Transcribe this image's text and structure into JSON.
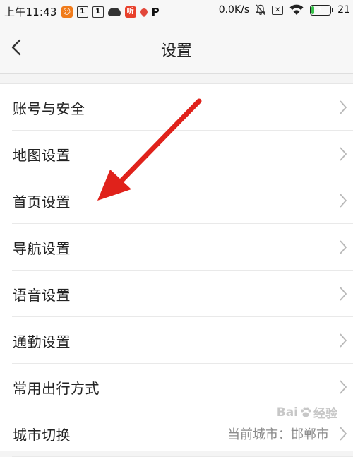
{
  "status_bar": {
    "time": "上午11:43",
    "icons": [
      {
        "name": "app-notification-icon",
        "glyph": "☺",
        "style": "orange"
      },
      {
        "name": "box-one-icon",
        "glyph": "1",
        "style": "box"
      },
      {
        "name": "box-one-icon",
        "glyph": "1",
        "style": "box"
      },
      {
        "name": "cloud-icon",
        "glyph": "",
        "style": "cloud"
      },
      {
        "name": "listen-app-icon",
        "glyph": "听",
        "style": "red"
      },
      {
        "name": "location-pin-icon",
        "glyph": "",
        "style": "pin"
      },
      {
        "name": "p-app-icon",
        "glyph": "P",
        "style": "p"
      }
    ],
    "net_speed": "0.0K/s",
    "battery_level": "21",
    "battery_percent": 0.21,
    "accent_green": "#37c24a"
  },
  "header": {
    "title": "设置",
    "back_icon": "chevron-left-icon"
  },
  "settings": {
    "items": [
      {
        "label": "账号与安全",
        "value": ""
      },
      {
        "label": "地图设置",
        "value": ""
      },
      {
        "label": "首页设置",
        "value": ""
      },
      {
        "label": "导航设置",
        "value": ""
      },
      {
        "label": "语音设置",
        "value": ""
      },
      {
        "label": "通勤设置",
        "value": ""
      },
      {
        "label": "常用出行方式",
        "value": ""
      },
      {
        "label": "城市切换",
        "value": "当前城市：邯郸市"
      }
    ]
  },
  "annotation": {
    "color": "#e0221b"
  },
  "watermark": {
    "text_prefix": "Bai",
    "text_suffix": "经验"
  }
}
